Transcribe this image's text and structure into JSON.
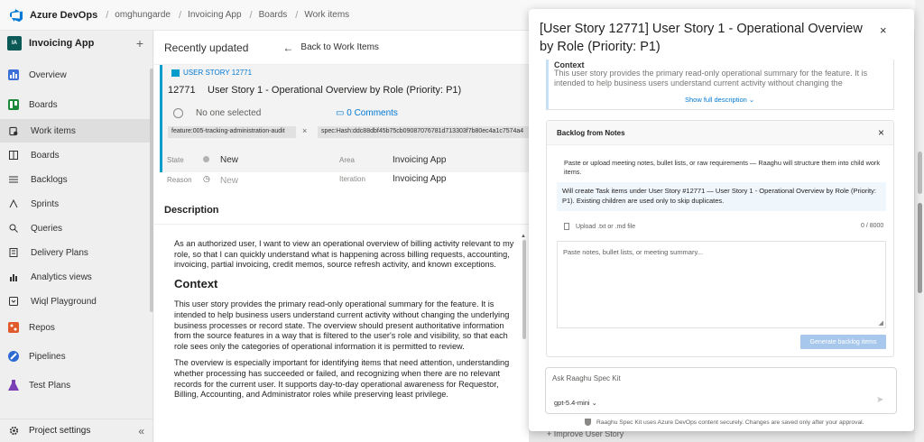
{
  "topbar": {
    "brand": "Azure DevOps",
    "breadcrumbs": [
      "omghungarde",
      "Invoicing App",
      "Boards",
      "Work items"
    ],
    "separator": "/"
  },
  "leftnav": {
    "project_avatar": "IA",
    "project_name": "Invoicing App",
    "add_icon": "+",
    "items": [
      {
        "label": "Overview",
        "icon": "overview-icon",
        "color": "#3c6fd8"
      },
      {
        "label": "Boards",
        "icon": "boards-icon",
        "color": "#1b8a3a"
      },
      {
        "label": "Work items",
        "icon": "work-items-icon"
      },
      {
        "label": "Boards",
        "icon": "board-icon"
      },
      {
        "label": "Backlogs",
        "icon": "backlogs-icon"
      },
      {
        "label": "Sprints",
        "icon": "sprints-icon"
      },
      {
        "label": "Queries",
        "icon": "queries-icon"
      },
      {
        "label": "Delivery Plans",
        "icon": "delivery-plans-icon"
      },
      {
        "label": "Analytics views",
        "icon": "analytics-icon"
      },
      {
        "label": "Wiql Playground",
        "icon": "wiql-icon"
      },
      {
        "label": "Repos",
        "icon": "repos-icon",
        "color": "#e05a2b"
      },
      {
        "label": "Pipelines",
        "icon": "pipelines-icon",
        "color": "#2d6bd3"
      },
      {
        "label": "Test Plans",
        "icon": "test-plans-icon",
        "color": "#7a3fb5"
      }
    ],
    "settings": "Project settings",
    "collapse": "«"
  },
  "main": {
    "header_title": "Recently updated",
    "back_label": "Back to Work Items",
    "back_arrow": "←",
    "work_item": {
      "type": "USER STORY 12771",
      "id": "12771",
      "title": "User Story 1 - Operational Overview by Role (Priority: P1)",
      "assignee": "No one selected",
      "comments": "0 Comments",
      "tags": [
        "feature:005-tracking-administration-audit",
        "spec:Hash:ddc88dbf45b75cb09087076781d713303f7b80ec4a1c7574a4"
      ],
      "tag_remove": "×",
      "state_label": "State",
      "state_value": "New",
      "reason_label": "Reason",
      "reason_value": "New",
      "area_label": "Area",
      "area_value": "Invoicing App",
      "iteration_label": "Iteration",
      "iteration_value": "Invoicing App"
    },
    "description": {
      "heading": "Description",
      "para1": "As an authorized user, I want to view an operational overview of billing activity relevant to my role, so that I can quickly understand what is happening across billing requests, accounting, invoicing, partial invoicing, credit memos, source refresh activity, and known exceptions.",
      "context_heading": "Context",
      "para2": "This user story provides the primary read-only operational summary for the feature. It is intended to help business users understand current activity without changing the underlying business processes or record state. The overview should present authoritative information from the source features in a way that is filtered to the user's role and visibility, so that each role sees only the categories of operational information it is permitted to review.",
      "para3": "The overview is especially important for identifying items that need attention, understanding whether processing has succeeded or failed, and recognizing when there are no relevant records for the current user. It supports day-to-day operational awareness for Requestor, Billing, Accounting, and Administrator roles while preserving least privilege."
    },
    "improve": "+ Improve User Story"
  },
  "panel": {
    "title": "[User Story 12771] User Story 1 - Operational Overview by Role (Priority: P1)",
    "close": "×",
    "context_label": "Context",
    "context_text": "This user story provides the primary read-only operational summary for the feature. It is intended to help business users understand current activity without changing the",
    "show_more": "Show full description ⌄",
    "backlog": {
      "title": "Backlog from Notes",
      "close": "×",
      "intro": "Paste or upload meeting notes, bullet lists, or raw requirements — Raaghu will structure them into child work items.",
      "info": "Will create Task items under User Story #12771 — User Story 1 - Operational Overview by Role (Priority: P1). Existing children are used only to skip duplicates.",
      "upload": "Upload .txt or .md file",
      "count": "0 / 8000",
      "placeholder": "Paste notes, bullet lists, or meeting summary...",
      "generate": "Generate backlog items"
    },
    "ask_placeholder": "Ask Raaghu Spec Kit",
    "model": "gpt-5.4-mini ⌄",
    "send": "➤",
    "footer": "Raaghu Spec Kit uses Azure DevOps content securely. Changes are saved only after your approval."
  }
}
